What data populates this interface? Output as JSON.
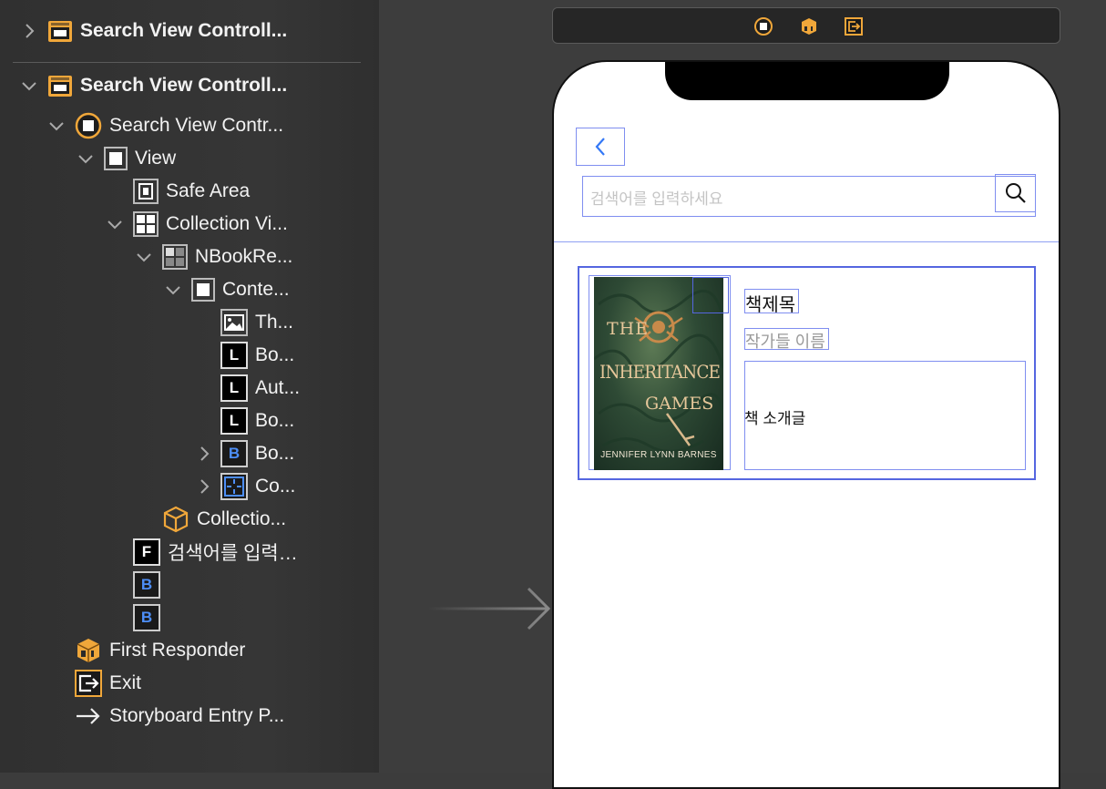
{
  "outline": {
    "scene1_title": "Search View Controll...",
    "scene2_title": "Search View Controll...",
    "controller": "Search View Contr...",
    "view": "View",
    "safe_area": "Safe Area",
    "collection_view": "Collection Vi...",
    "cell": "NBookRe...",
    "content_view": "Conte...",
    "thumbnail": "Th...",
    "book_label": "Bo...",
    "author_label": "Aut...",
    "book_label2": "Bo...",
    "book_button": "Bo...",
    "constraints": "Co...",
    "collection_layout": "Collectio...",
    "textfield": "검색어를 입력…",
    "first_responder": "First Responder",
    "exit": "Exit",
    "entry_point": "Storyboard Entry P..."
  },
  "icons": {
    "l": "L",
    "f": "F",
    "b": "B"
  },
  "device": {
    "search_placeholder": "검색어를 입력하세요",
    "book_title": "책제목",
    "book_authors": "작가들 이름",
    "book_intro": "책 소개글",
    "cover": {
      "top_text": "THE",
      "title1": "INHERITANCE",
      "title2": "GAMES",
      "author": "JENNIFER LYNN BARNES"
    }
  },
  "colors": {
    "accent_orange": "#f0a73a",
    "selection_blue": "#7f8ef0",
    "button_blue": "#4d8ef7"
  }
}
